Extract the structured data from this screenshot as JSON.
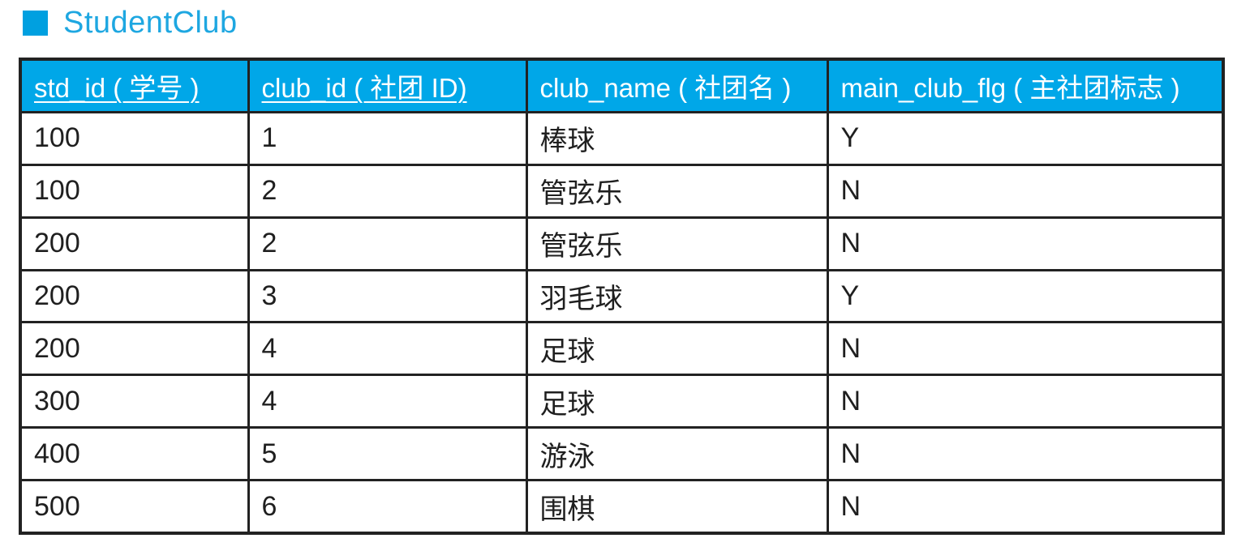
{
  "title": "StudentClub",
  "colors": {
    "accent": "#00a7e8",
    "title_text": "#1ea7e1",
    "border": "#222222"
  },
  "table": {
    "headers": [
      "std_id ( 学号 )",
      "club_id ( 社团 ID)",
      "club_name ( 社团名 )",
      "main_club_flg ( 主社团标志 )"
    ],
    "rows": [
      [
        "100",
        "1",
        "棒球",
        "Y"
      ],
      [
        "100",
        "2",
        "管弦乐",
        "N"
      ],
      [
        "200",
        "2",
        "管弦乐",
        "N"
      ],
      [
        "200",
        "3",
        "羽毛球",
        "Y"
      ],
      [
        "200",
        "4",
        "足球",
        "N"
      ],
      [
        "300",
        "4",
        "足球",
        "N"
      ],
      [
        "400",
        "5",
        "游泳",
        "N"
      ],
      [
        "500",
        "6",
        "围棋",
        "N"
      ]
    ]
  }
}
